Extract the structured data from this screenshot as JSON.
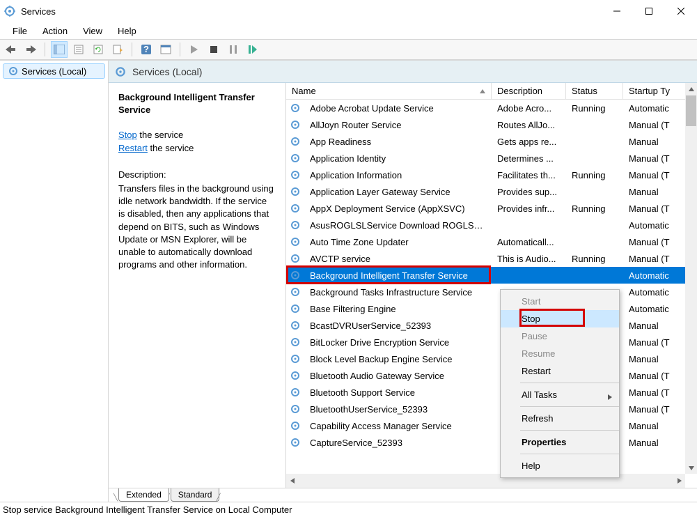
{
  "window": {
    "title": "Services"
  },
  "menu": [
    "File",
    "Action",
    "View",
    "Help"
  ],
  "tree": {
    "root": "Services (Local)"
  },
  "snap_header": "Services (Local)",
  "detail": {
    "title": "Background Intelligent Transfer Service",
    "link_stop": "Stop",
    "link_stop_suffix": " the service",
    "link_restart": "Restart",
    "link_restart_suffix": " the service",
    "desc_label": "Description:",
    "desc": "Transfers files in the background using idle network bandwidth. If the service is disabled, then any applications that depend on BITS, such as Windows Update or MSN Explorer, will be unable to automatically download programs and other information."
  },
  "columns": [
    "Name",
    "Description",
    "Status",
    "Startup Ty"
  ],
  "services": [
    {
      "name": "Adobe Acrobat Update Service",
      "desc": "Adobe Acro...",
      "status": "Running",
      "startup": "Automatic"
    },
    {
      "name": "AllJoyn Router Service",
      "desc": "Routes AllJo...",
      "status": "",
      "startup": "Manual (T"
    },
    {
      "name": "App Readiness",
      "desc": "Gets apps re...",
      "status": "",
      "startup": "Manual"
    },
    {
      "name": "Application Identity",
      "desc": "Determines ...",
      "status": "",
      "startup": "Manual (T"
    },
    {
      "name": "Application Information",
      "desc": "Facilitates th...",
      "status": "Running",
      "startup": "Manual (T"
    },
    {
      "name": "Application Layer Gateway Service",
      "desc": "Provides sup...",
      "status": "",
      "startup": "Manual"
    },
    {
      "name": "AppX Deployment Service (AppXSVC)",
      "desc": "Provides infr...",
      "status": "Running",
      "startup": "Manual (T"
    },
    {
      "name": "AsusROGLSLService Download ROGLSL...",
      "desc": "",
      "status": "",
      "startup": "Automatic"
    },
    {
      "name": "Auto Time Zone Updater",
      "desc": "Automaticall...",
      "status": "",
      "startup": "Manual (T"
    },
    {
      "name": "AVCTP service",
      "desc": "This is Audio...",
      "status": "Running",
      "startup": "Manual (T"
    },
    {
      "name": "Background Intelligent Transfer Service",
      "desc": "",
      "status": "",
      "startup": "Automatic",
      "selected": true
    },
    {
      "name": "Background Tasks Infrastructure Service",
      "desc": "",
      "status": "",
      "startup": "Automatic"
    },
    {
      "name": "Base Filtering Engine",
      "desc": "",
      "status": "",
      "startup": "Automatic"
    },
    {
      "name": "BcastDVRUserService_52393",
      "desc": "",
      "status": "",
      "startup": "Manual"
    },
    {
      "name": "BitLocker Drive Encryption Service",
      "desc": "",
      "status": "",
      "startup": "Manual (T"
    },
    {
      "name": "Block Level Backup Engine Service",
      "desc": "",
      "status": "",
      "startup": "Manual"
    },
    {
      "name": "Bluetooth Audio Gateway Service",
      "desc": "",
      "status": "",
      "startup": "Manual (T"
    },
    {
      "name": "Bluetooth Support Service",
      "desc": "",
      "status": "",
      "startup": "Manual (T"
    },
    {
      "name": "BluetoothUserService_52393",
      "desc": "",
      "status": "",
      "startup": "Manual (T"
    },
    {
      "name": "Capability Access Manager Service",
      "desc": "",
      "status": "",
      "startup": "Manual"
    },
    {
      "name": "CaptureService_52393",
      "desc": "",
      "status": "",
      "startup": "Manual"
    }
  ],
  "context_menu": {
    "items": [
      {
        "label": "Start",
        "disabled": true
      },
      {
        "label": "Stop",
        "highlight": true
      },
      {
        "label": "Pause",
        "disabled": true
      },
      {
        "label": "Resume",
        "disabled": true
      },
      {
        "label": "Restart"
      },
      {
        "sep": true
      },
      {
        "label": "All Tasks",
        "submenu": true
      },
      {
        "sep": true
      },
      {
        "label": "Refresh"
      },
      {
        "sep": true
      },
      {
        "label": "Properties",
        "bold": true
      },
      {
        "sep": true
      },
      {
        "label": "Help"
      }
    ]
  },
  "tabs": [
    "Extended",
    "Standard"
  ],
  "status": "Stop service Background Intelligent Transfer Service on Local Computer"
}
